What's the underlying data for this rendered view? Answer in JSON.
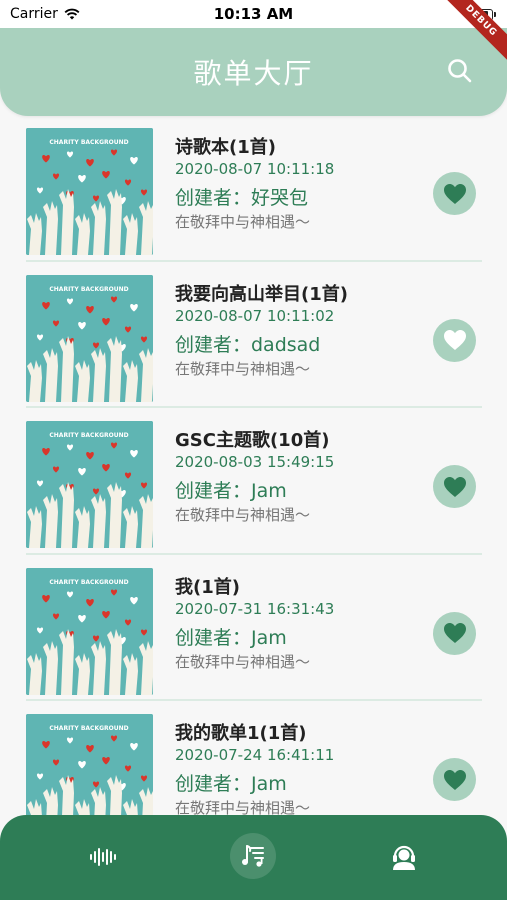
{
  "status_bar": {
    "carrier": "Carrier",
    "time": "10:13 AM"
  },
  "debug_banner": "DEBUG",
  "header": {
    "title": "歌单大厅",
    "search_icon": "search-icon"
  },
  "playlists": [
    {
      "title": "诗歌本(1首)",
      "created_at": "2020-08-07 10:11:18",
      "creator": "创建者：好哭包",
      "description": "在敬拜中与神相遇～",
      "favorited": true,
      "cover_text": "CHARITY BACKGROUND"
    },
    {
      "title": "我要向高山举目(1首)",
      "created_at": "2020-08-07 10:11:02",
      "creator": "创建者：dadsad",
      "description": "在敬拜中与神相遇～",
      "favorited": false,
      "cover_text": "CHARITY BACKGROUND"
    },
    {
      "title": "GSC主题歌(10首)",
      "created_at": "2020-08-03 15:49:15",
      "creator": "创建者：Jam",
      "description": "在敬拜中与神相遇～",
      "favorited": true,
      "cover_text": "CHARITY BACKGROUND"
    },
    {
      "title": "我(1首)",
      "created_at": "2020-07-31 16:31:43",
      "creator": "创建者：Jam",
      "description": "在敬拜中与神相遇～",
      "favorited": true,
      "cover_text": "CHARITY BACKGROUND"
    },
    {
      "title": "我的歌单1(1首)",
      "created_at": "2020-07-24 16:41:11",
      "creator": "创建者：Jam",
      "description": "在敬拜中与神相遇～",
      "favorited": true,
      "cover_text": "CHARITY BACKGROUND"
    }
  ],
  "bottom_nav": {
    "items": [
      {
        "icon": "waveform-icon",
        "active": false
      },
      {
        "icon": "music-list-icon",
        "active": true
      },
      {
        "icon": "user-headset-icon",
        "active": false
      }
    ]
  },
  "colors": {
    "header": "#a9d1be",
    "accent": "#2e7d56",
    "cover": "#5fb5b3",
    "heart_active": "#2e7d56",
    "heart_inactive": "#ffffff"
  }
}
